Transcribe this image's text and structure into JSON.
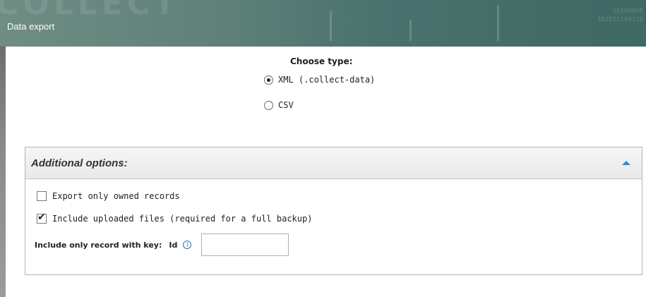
{
  "header": {
    "title": "Data export",
    "logo_text": "COLLECT",
    "binary_lines": [
      "10100000",
      "101011100110"
    ]
  },
  "export_type": {
    "label": "Choose type:",
    "options": [
      {
        "label": "XML (.collect-data)",
        "selected": true
      },
      {
        "label": "CSV",
        "selected": false
      }
    ]
  },
  "additional_options": {
    "title": "Additional options:",
    "expanded": true,
    "accent_color": "#2b8fd0",
    "export_owned": {
      "label": "Export only owned records",
      "checked": false
    },
    "include_files": {
      "label": "Include uploaded files (required for a full backup)",
      "checked": true
    },
    "record_key": {
      "label": "Include only record with key:",
      "key_name": "Id",
      "info_icon": "info-icon",
      "value": ""
    }
  }
}
